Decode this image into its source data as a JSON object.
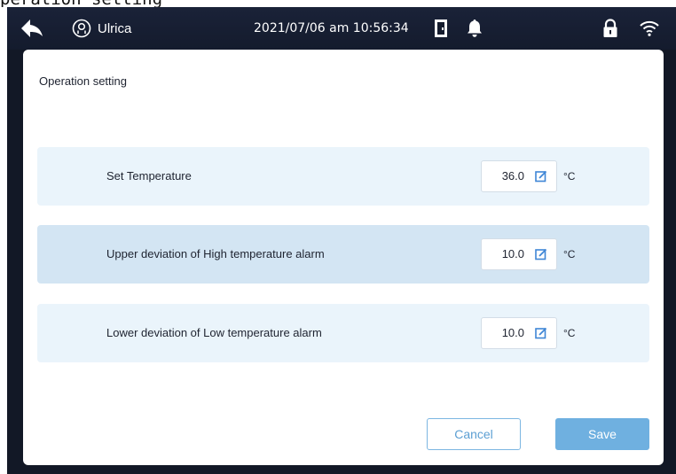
{
  "caption": "peration setting",
  "statusbar": {
    "user_name": "Ulrica",
    "datetime": "2021/07/06 am 10:56:34",
    "icons": [
      "back-arrow-icon",
      "user-icon",
      "door-icon",
      "bell-icon",
      "lock-icon",
      "wifi-icon"
    ]
  },
  "panel": {
    "title": "Operation setting",
    "rows": [
      {
        "label": "Set Temperature",
        "value": "36.0",
        "unit": "°C"
      },
      {
        "label": "Upper deviation of High temperature alarm",
        "value": "10.0",
        "unit": "°C"
      },
      {
        "label": "Lower deviation of Low temperature alarm",
        "value": "10.0",
        "unit": "°C"
      }
    ],
    "cancel_label": "Cancel",
    "save_label": "Save"
  },
  "colors": {
    "statusbar_bg": "#141b2d",
    "row_light": "#eaf4fb",
    "row_dark": "#d3e5f3",
    "accent": "#6fb0e0",
    "edit_icon": "#3f86d6"
  }
}
